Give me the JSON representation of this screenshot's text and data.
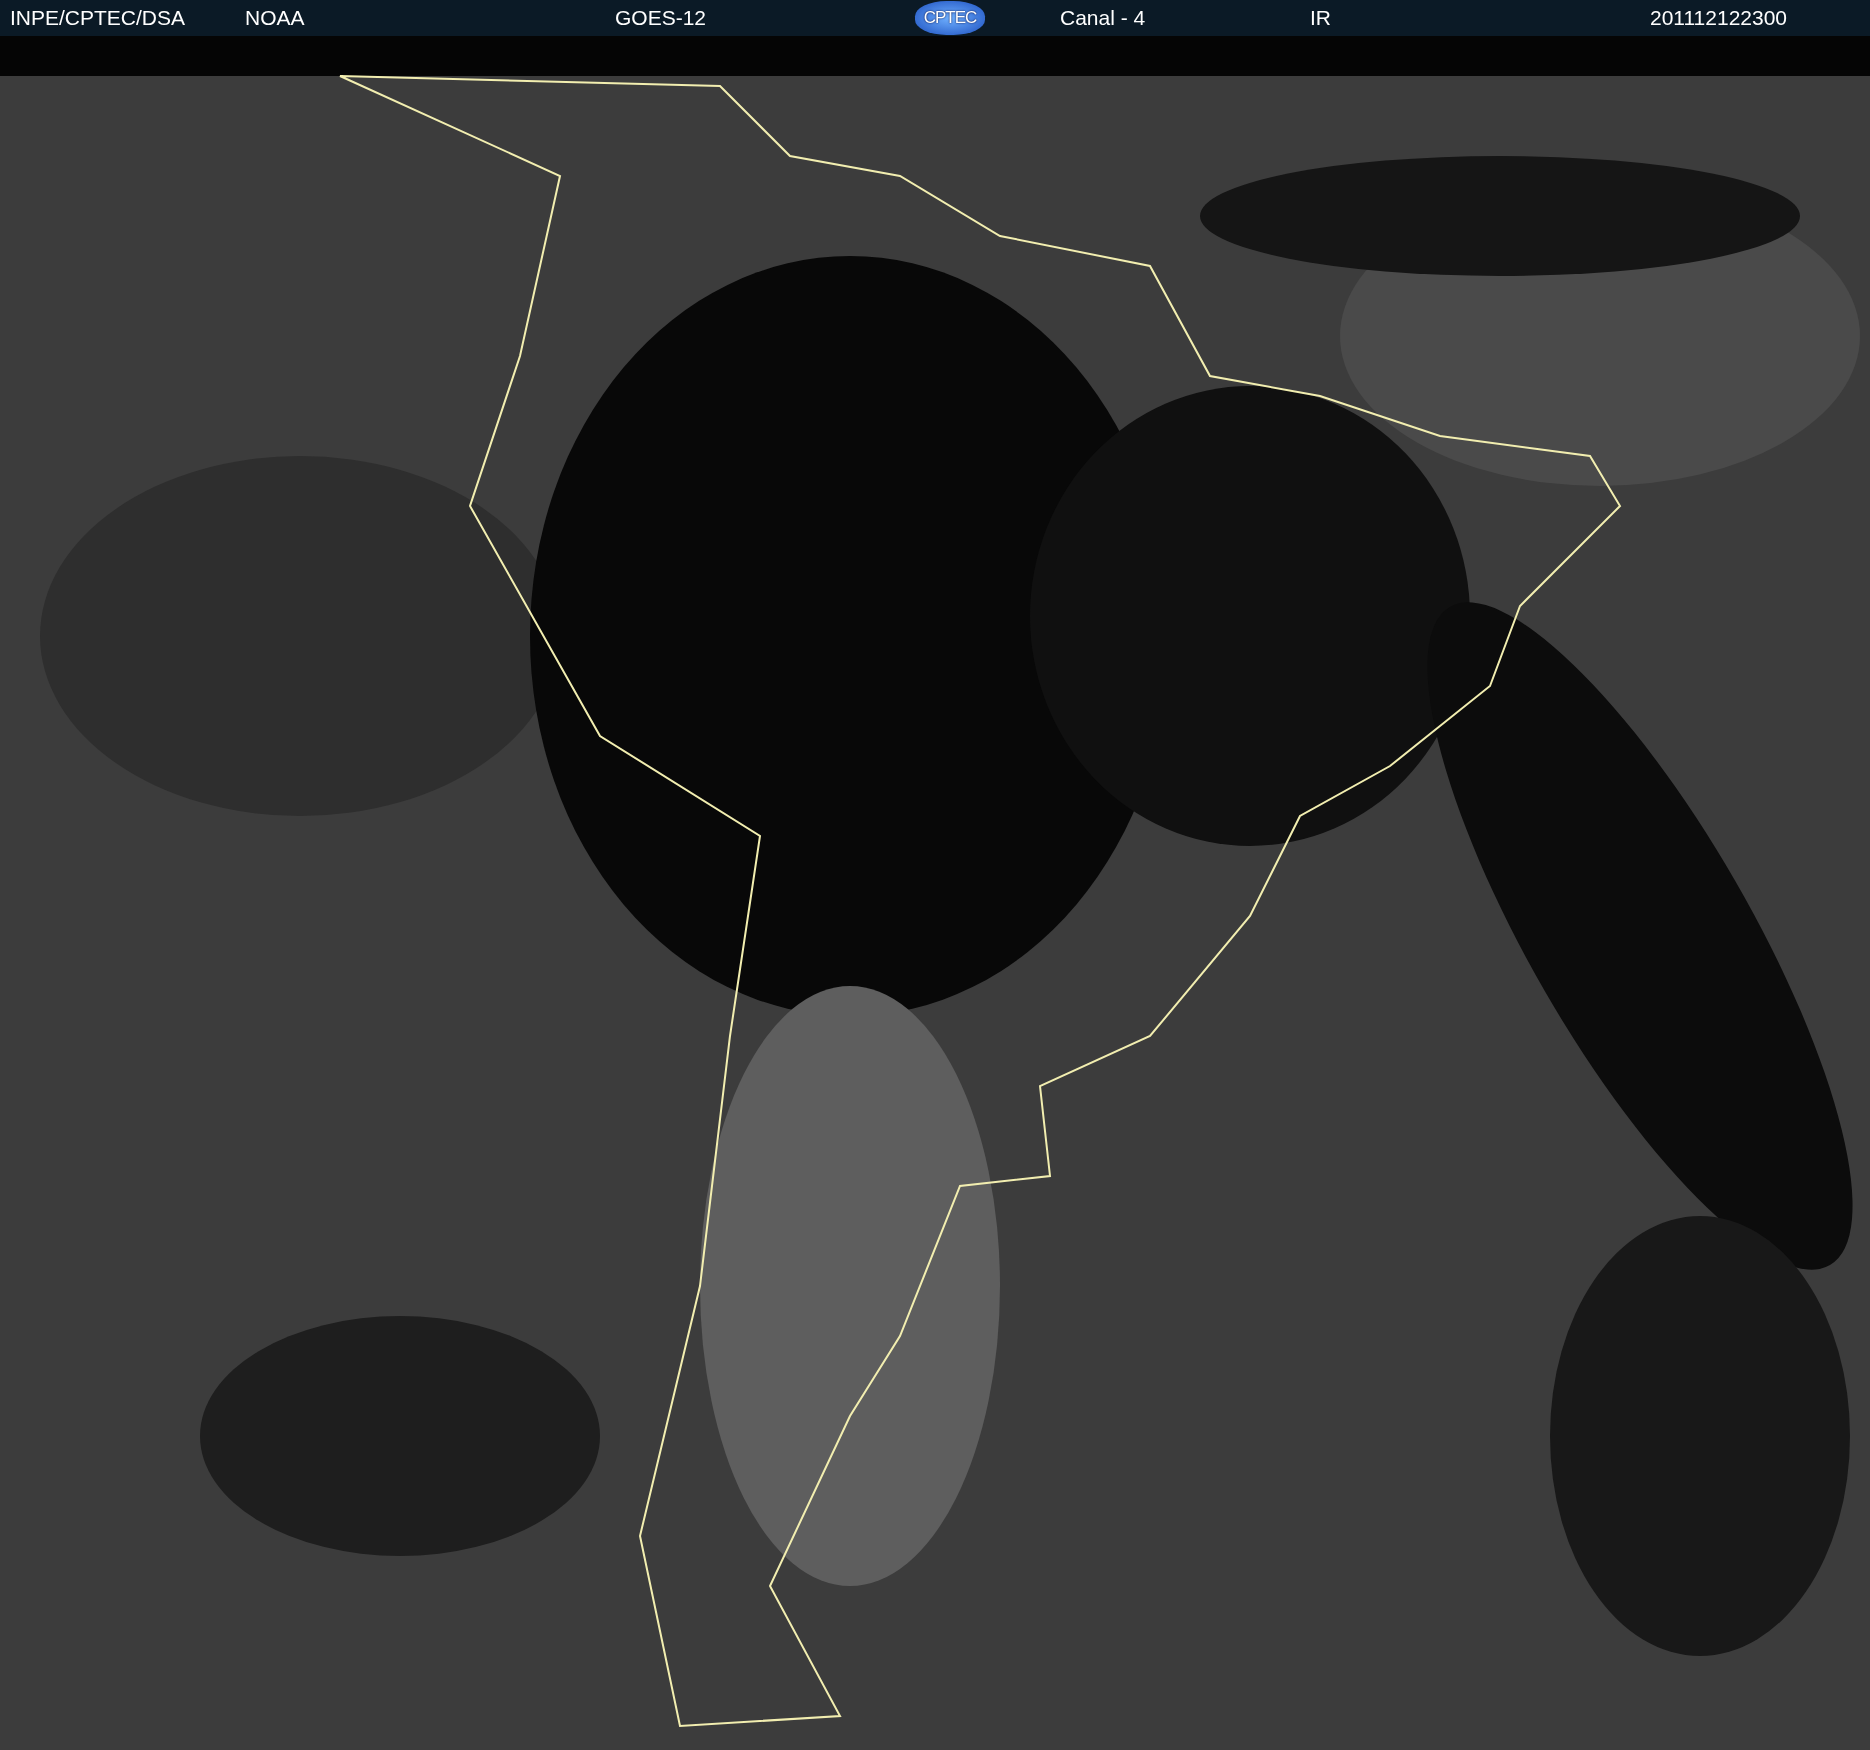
{
  "header": {
    "items": [
      {
        "kind": "text",
        "text": "INPE/CPTEC/DSA"
      },
      {
        "kind": "text",
        "text": "NOAA"
      },
      {
        "kind": "text",
        "text": "GOES-12"
      },
      {
        "kind": "logo",
        "text": "CPTEC"
      },
      {
        "kind": "text",
        "text": "Canal - 4"
      },
      {
        "kind": "text",
        "text": "IR"
      },
      {
        "kind": "text",
        "text": "201112122300"
      }
    ]
  }
}
